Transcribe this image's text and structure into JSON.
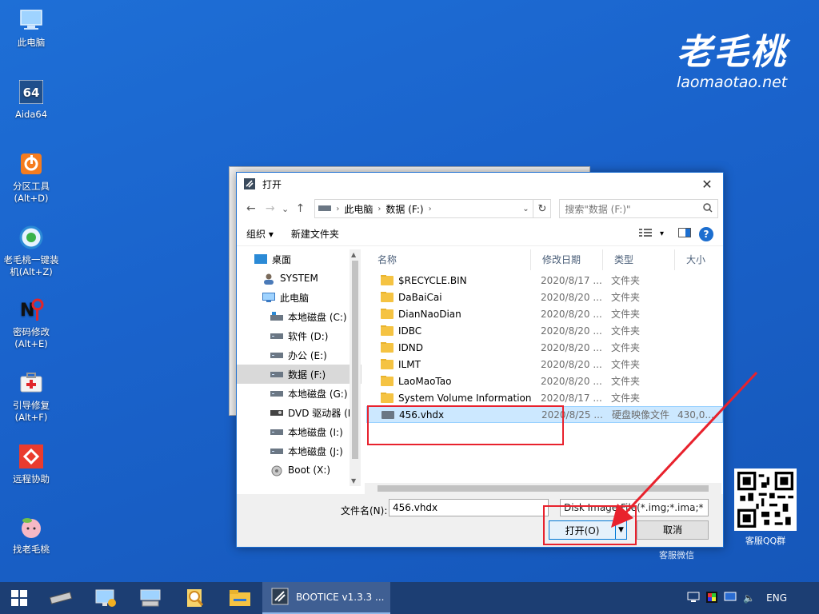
{
  "desktop": {
    "icons": [
      {
        "label": "此电脑",
        "icon": "computer-icon"
      },
      {
        "label": "Aida64",
        "icon": "aida64-icon"
      },
      {
        "label": "分区工具\n(Alt+D)",
        "icon": "partition-tool-icon"
      },
      {
        "label": "老毛桃一键装\n机(Alt+Z)",
        "icon": "one-click-install-icon"
      },
      {
        "label": "密码修改\n(Alt+E)",
        "icon": "password-key-icon"
      },
      {
        "label": "引导修复\n(Alt+F)",
        "icon": "boot-repair-icon"
      },
      {
        "label": "远程协助",
        "icon": "remote-assist-icon"
      },
      {
        "label": "找老毛桃",
        "icon": "peach-icon"
      }
    ],
    "brand": {
      "name": "老毛桃",
      "url": "laomaotao.net"
    }
  },
  "dialog": {
    "title": "打开",
    "nav": {
      "back": "←",
      "forward": "→",
      "recent": "⌄",
      "up": "↑",
      "breadcrumb": [
        "此电脑",
        "数据 (F:)"
      ],
      "search_placeholder": "搜索\"数据 (F:)\""
    },
    "toolbar": {
      "organize": "组织 ▾",
      "new_folder": "新建文件夹"
    },
    "tree": [
      {
        "label": "桌面",
        "icon": "desktop-icon",
        "indent": 0
      },
      {
        "label": "SYSTEM",
        "icon": "user-icon",
        "indent": 1
      },
      {
        "label": "此电脑",
        "icon": "computer-icon",
        "indent": 1
      },
      {
        "label": "本地磁盘 (C:)",
        "icon": "system-drive-icon",
        "indent": 2
      },
      {
        "label": "软件 (D:)",
        "icon": "drive-icon",
        "indent": 2
      },
      {
        "label": "办公 (E:)",
        "icon": "drive-icon",
        "indent": 2
      },
      {
        "label": "数据 (F:)",
        "icon": "drive-icon",
        "indent": 2,
        "selected": true
      },
      {
        "label": "本地磁盘 (G:)",
        "icon": "drive-icon",
        "indent": 2
      },
      {
        "label": "DVD 驱动器 (H",
        "icon": "dvd-icon",
        "indent": 2
      },
      {
        "label": "本地磁盘 (I:)",
        "icon": "drive-icon",
        "indent": 2
      },
      {
        "label": "本地磁盘 (J:)",
        "icon": "drive-icon",
        "indent": 2
      },
      {
        "label": "Boot (X:)",
        "icon": "boot-drive-icon",
        "indent": 2
      }
    ],
    "columns": [
      "名称",
      "修改日期",
      "类型",
      "大小"
    ],
    "files": [
      {
        "name": "$RECYCLE.BIN",
        "date": "2020/8/17 ...",
        "type": "文件夹",
        "size": "",
        "kind": "folder"
      },
      {
        "name": "DaBaiCai",
        "date": "2020/8/20 ...",
        "type": "文件夹",
        "size": "",
        "kind": "folder"
      },
      {
        "name": "DianNaoDian",
        "date": "2020/8/20 ...",
        "type": "文件夹",
        "size": "",
        "kind": "folder"
      },
      {
        "name": "IDBC",
        "date": "2020/8/20 ...",
        "type": "文件夹",
        "size": "",
        "kind": "folder"
      },
      {
        "name": "IDND",
        "date": "2020/8/20 ...",
        "type": "文件夹",
        "size": "",
        "kind": "folder"
      },
      {
        "name": "ILMT",
        "date": "2020/8/20 ...",
        "type": "文件夹",
        "size": "",
        "kind": "folder"
      },
      {
        "name": "LaoMaoTao",
        "date": "2020/8/20 ...",
        "type": "文件夹",
        "size": "",
        "kind": "folder"
      },
      {
        "name": "System Volume Information",
        "date": "2020/8/17 ...",
        "type": "文件夹",
        "size": "",
        "kind": "folder"
      },
      {
        "name": "456.vhdx",
        "date": "2020/8/25 ...",
        "type": "硬盘映像文件",
        "size": "430,0...",
        "kind": "file",
        "selected": true
      }
    ],
    "footer": {
      "filename_label": "文件名(N):",
      "filename_value": "456.vhdx",
      "filetype_value": "Disk Image File(*.img;*.ima;*",
      "open_label": "打开(O)",
      "cancel_label": "取消"
    }
  },
  "qr": {
    "left_caption": "客服微信",
    "right_caption": "客服QQ群"
  },
  "taskbar": {
    "task_label": "BOOTICE v1.3.3 ...",
    "language": "ENG"
  },
  "colors": {
    "accent": "#1c6ecf",
    "highlight": "#e8222d",
    "desktop": "#1a63cc"
  }
}
